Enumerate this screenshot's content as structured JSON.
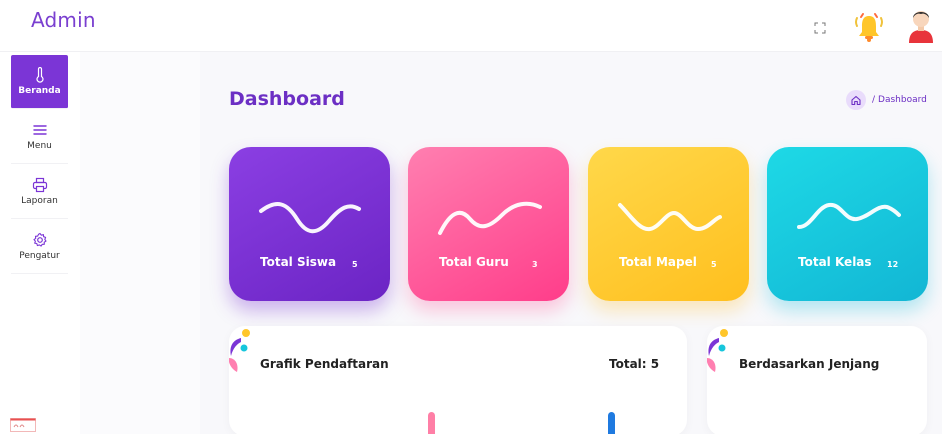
{
  "header": {
    "brand": "Admin",
    "icons": [
      "fullscreen-icon",
      "bell-icon",
      "user-avatar"
    ]
  },
  "sidebar": {
    "items": [
      {
        "label": "Beranda",
        "icon": "thermometer-icon",
        "active": true
      },
      {
        "label": "Menu",
        "icon": "hamburger-icon",
        "active": false
      },
      {
        "label": "Laporan",
        "icon": "printer-icon",
        "active": false
      },
      {
        "label": "Pengatur",
        "icon": "gear-icon",
        "active": false
      }
    ]
  },
  "page": {
    "title": "Dashboard",
    "breadcrumb": {
      "separator": "/",
      "current": "Dashboard"
    }
  },
  "stats": [
    {
      "label": "Total Siswa",
      "count": "5",
      "color": "#7b35d6"
    },
    {
      "label": "Total Guru",
      "count": "3",
      "color": "#ff4f96"
    },
    {
      "label": "Total Mapel",
      "count": "5",
      "color": "#ffc62a"
    },
    {
      "label": "Total Kelas",
      "count": "12",
      "color": "#16c6dc"
    }
  ],
  "panels": {
    "chart": {
      "title": "Grafik Pendaftaran",
      "total": "Total: 5"
    },
    "level": {
      "title": "Berdasarkan Jenjang"
    }
  },
  "colors": {
    "accent": "#7b35d6",
    "pink": "#ff4f96",
    "yellow": "#ffc62a",
    "cyan": "#16c6dc",
    "blue": "#1f7ae0"
  }
}
